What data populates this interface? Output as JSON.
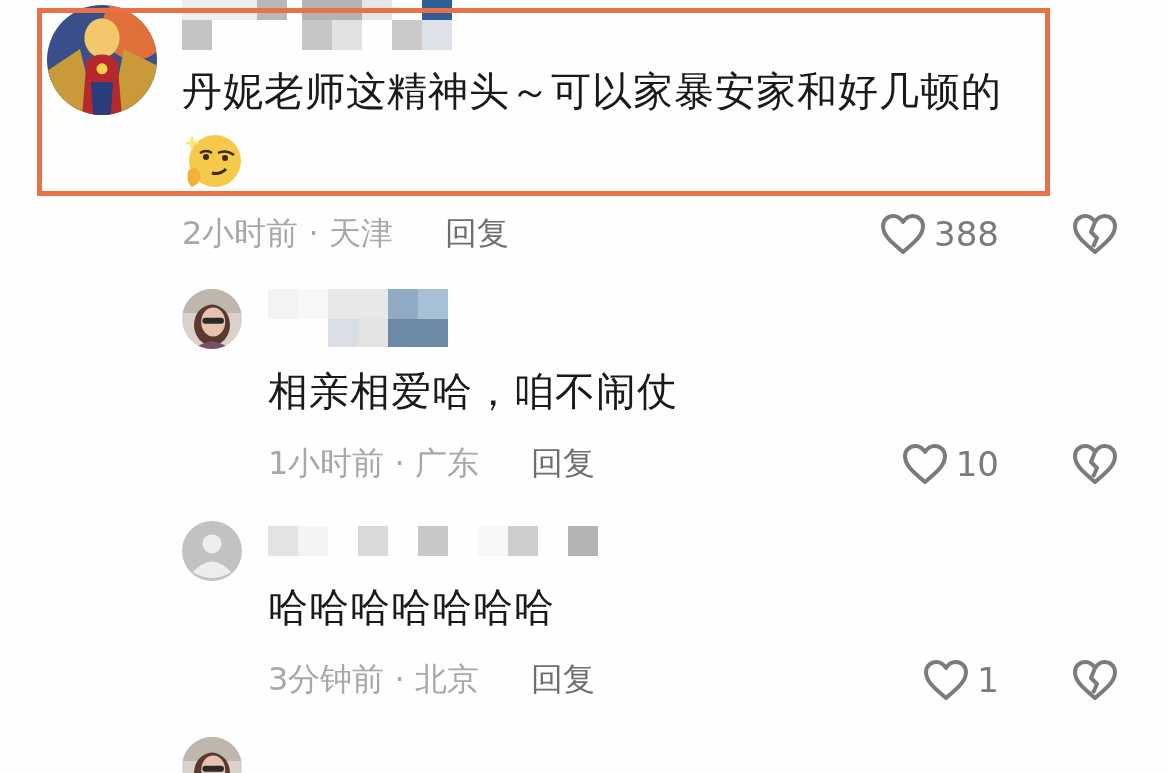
{
  "comments": [
    {
      "kind": "full",
      "default_avatar": false,
      "highlighted": true,
      "text": "丹妮老师这精神头～可以家暴安家和好几顿的",
      "emoji": true,
      "meta": "2小时前 · 天津",
      "reply": "回复",
      "likes": "388",
      "children": [
        {
          "kind": "full",
          "default_avatar": false,
          "highlighted": false,
          "text": "相亲相爱哈，咱不闹仗",
          "emoji": false,
          "meta": "1小时前 · 广东",
          "reply": "回复",
          "likes": "10"
        },
        {
          "kind": "full",
          "default_avatar": true,
          "highlighted": false,
          "text": "哈哈哈哈哈哈哈",
          "emoji": false,
          "meta": "3分钟前 · 北京",
          "reply": "回复",
          "likes": "1"
        },
        {
          "kind": "partial",
          "default_avatar": false
        }
      ]
    }
  ]
}
